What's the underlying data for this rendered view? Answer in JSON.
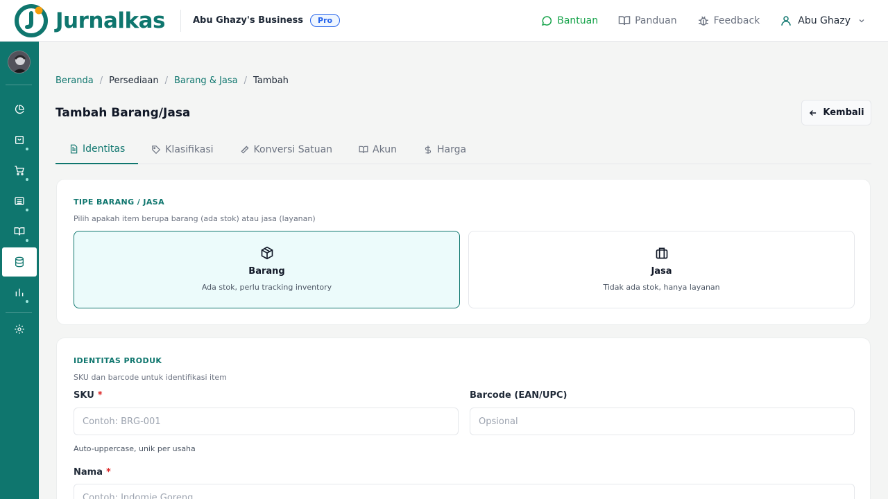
{
  "header": {
    "logo_text": "Jurnalkas",
    "business_name": "Abu Ghazy's Business",
    "plan_badge": "Pro",
    "links": [
      {
        "label": "Bantuan",
        "icon": "chat-bubble-icon"
      },
      {
        "label": "Panduan",
        "icon": "book-icon"
      },
      {
        "label": "Feedback",
        "icon": "bug-icon"
      }
    ],
    "user_name": "Abu Ghazy"
  },
  "colors": {
    "brand": "#0f766e",
    "help": "#16a34a",
    "badge": "#2563eb",
    "required": "#dc2626"
  },
  "sidebar": {
    "items": [
      {
        "name": "dashboard",
        "icon": "pie-chart-icon"
      },
      {
        "name": "sales",
        "icon": "shopping-bag-icon"
      },
      {
        "name": "purchases",
        "icon": "cart-icon"
      },
      {
        "name": "cash-bank",
        "icon": "wallet-icon"
      },
      {
        "name": "ledger",
        "icon": "book-open-icon"
      },
      {
        "name": "inventory",
        "icon": "database-icon",
        "active": true
      },
      {
        "name": "reports",
        "icon": "bar-chart-icon"
      },
      {
        "name": "settings",
        "icon": "gear-icon"
      }
    ]
  },
  "breadcrumb": [
    "Beranda",
    "Persediaan",
    "Barang & Jasa",
    "Tambah"
  ],
  "page": {
    "title": "Tambah Barang/Jasa",
    "back_label": "Kembali"
  },
  "tabs": [
    {
      "label": "Identitas",
      "icon": "document-icon",
      "active": true
    },
    {
      "label": "Klasifikasi",
      "icon": "tag-icon"
    },
    {
      "label": "Konversi Satuan",
      "icon": "ruler-icon"
    },
    {
      "label": "Akun",
      "icon": "book-icon"
    },
    {
      "label": "Harga",
      "icon": "dollar-icon"
    }
  ],
  "type_section": {
    "title": "TIPE BARANG / JASA",
    "subtitle": "Pilih apakah item berupa barang (ada stok) atau jasa (layanan)",
    "options": [
      {
        "name": "Barang",
        "desc": "Ada stok, perlu tracking inventory",
        "icon": "box-icon",
        "selected": true
      },
      {
        "name": "Jasa",
        "desc": "Tidak ada stok, hanya layanan",
        "icon": "briefcase-icon",
        "selected": false
      }
    ]
  },
  "identity_section": {
    "title": "IDENTITAS PRODUK",
    "subtitle": "SKU dan barcode untuk identifikasi item",
    "sku": {
      "label": "SKU",
      "required": "*",
      "placeholder": "Contoh: BRG-001",
      "value": "",
      "hint": "Auto-uppercase, unik per usaha"
    },
    "barcode": {
      "label": "Barcode (EAN/UPC)",
      "placeholder": "Opsional",
      "value": ""
    },
    "name": {
      "label": "Nama",
      "required": "*",
      "placeholder": "Contoh: Indomie Goreng",
      "value": ""
    }
  }
}
